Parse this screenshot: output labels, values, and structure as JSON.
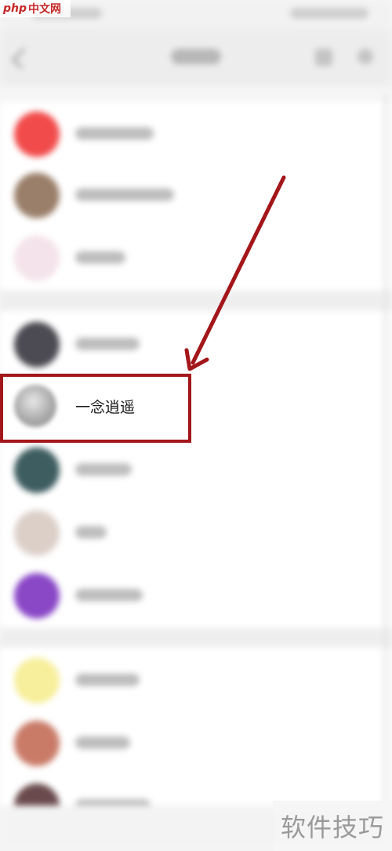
{
  "focused_contact": {
    "name": "一念逍遥"
  },
  "logo": {
    "brand": "php",
    "site": "中文网"
  },
  "watermark": {
    "text": "软件技巧"
  },
  "highlight": {
    "box_color": "#a3161a",
    "arrow_color": "#a3161a"
  },
  "contacts": [
    {
      "avatar_color": "#f24b4b"
    },
    {
      "avatar_color": "#9a7f6a"
    },
    {
      "avatar_color": "#f4e3ea"
    },
    {
      "avatar_color": "#4c4a52"
    },
    {
      "avatar_color": "#a7a7a7"
    },
    {
      "avatar_color": "#3e5d60"
    },
    {
      "avatar_color": "#dccfc8"
    },
    {
      "avatar_color": "#8a48c7"
    },
    {
      "avatar_color": "#f7ef9b"
    },
    {
      "avatar_color": "#c97b68"
    },
    {
      "avatar_color": "#6a4a4c"
    }
  ]
}
